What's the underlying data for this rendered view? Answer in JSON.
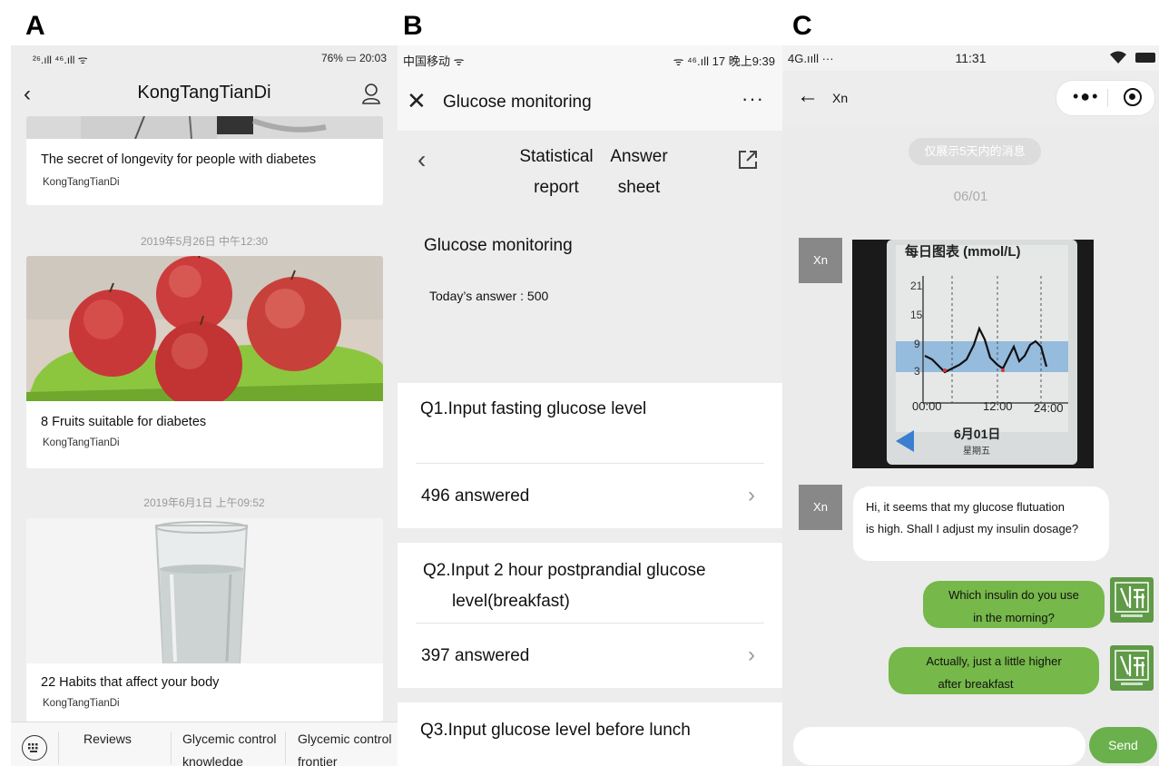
{
  "figure_labels": {
    "a": "A",
    "b": "B",
    "c": "C"
  },
  "panelA": {
    "status_left": "²⁶.ıll ⁴⁶.ıll ᯤ",
    "status_right": "76% ▭ 20:03",
    "title": "KongTangTianDi",
    "cards": [
      {
        "title": "The secret of longevity for people with diabetes",
        "author": "KongTangTianDi"
      },
      {
        "date": "2019年5月26日 中午12:30",
        "title": "8 Fruits suitable for diabetes",
        "author": "KongTangTianDi"
      },
      {
        "date": "2019年6月1日 上午09:52",
        "title": "22 Habits that affect your body",
        "author": "KongTangTianDi"
      }
    ],
    "menu": [
      {
        "line1": "Reviews",
        "line2": ""
      },
      {
        "line1": "Glycemic control",
        "line2": "knowledge"
      },
      {
        "line1": "Glycemic control",
        "line2": "frontier"
      }
    ]
  },
  "panelB": {
    "status_left": "中国移动 ᯤ",
    "status_right": "ᯤ ⁴⁶.ıll 17 晚上9:39",
    "title": "Glucose monitoring",
    "more": "···",
    "tabs": [
      {
        "line1": "Statistical",
        "line2": "report"
      },
      {
        "line1": "Answer",
        "line2": "sheet"
      }
    ],
    "survey_title": "Glucose monitoring",
    "today_answer": "Today’s answer : 500",
    "questions": [
      {
        "line1": "Q1.Input fasting glucose level",
        "line2": "",
        "answered": "496 answered"
      },
      {
        "line1": "Q2.Input 2 hour postprandial glucose",
        "line2": "level(breakfast)",
        "answered": "397 answered"
      },
      {
        "line1": "Q3.Input glucose level before lunch",
        "line2": "",
        "answered": ""
      }
    ]
  },
  "panelC": {
    "status_left": "4G.ııll ···",
    "time": "11:31",
    "contact": "Xn",
    "notice": "仅展示5天内的消息",
    "date": "06/01",
    "avatar_label": "Xn",
    "chart_image": {
      "title": "每日图表 (mmol/L)",
      "y_ticks": [
        "21",
        "15",
        "9",
        "3"
      ],
      "x_ticks": [
        "00:00",
        "12:00",
        "24:00"
      ],
      "date": "6月01日",
      "weekday": "星期五"
    },
    "messages": [
      {
        "from": "Xn",
        "text": "Hi, it seems that my glucose flutuation is high. Shall I adjust my insulin dosage?"
      },
      {
        "from": "me",
        "line1": "Which insulin do you use",
        "line2": "in the morning?"
      },
      {
        "from": "me",
        "line1": "Actually, just a little higher",
        "line2": "after breakfast"
      }
    ],
    "bubble1_line1": "Hi, it seems that my glucose flutuation",
    "bubble1_line2": "is high. Shall I adjust my insulin dosage?",
    "send_label": "Send",
    "colors": {
      "bubble_green": "#76b84a",
      "send_green": "#6ab04c",
      "avatar_green": "#5f9a47"
    }
  }
}
